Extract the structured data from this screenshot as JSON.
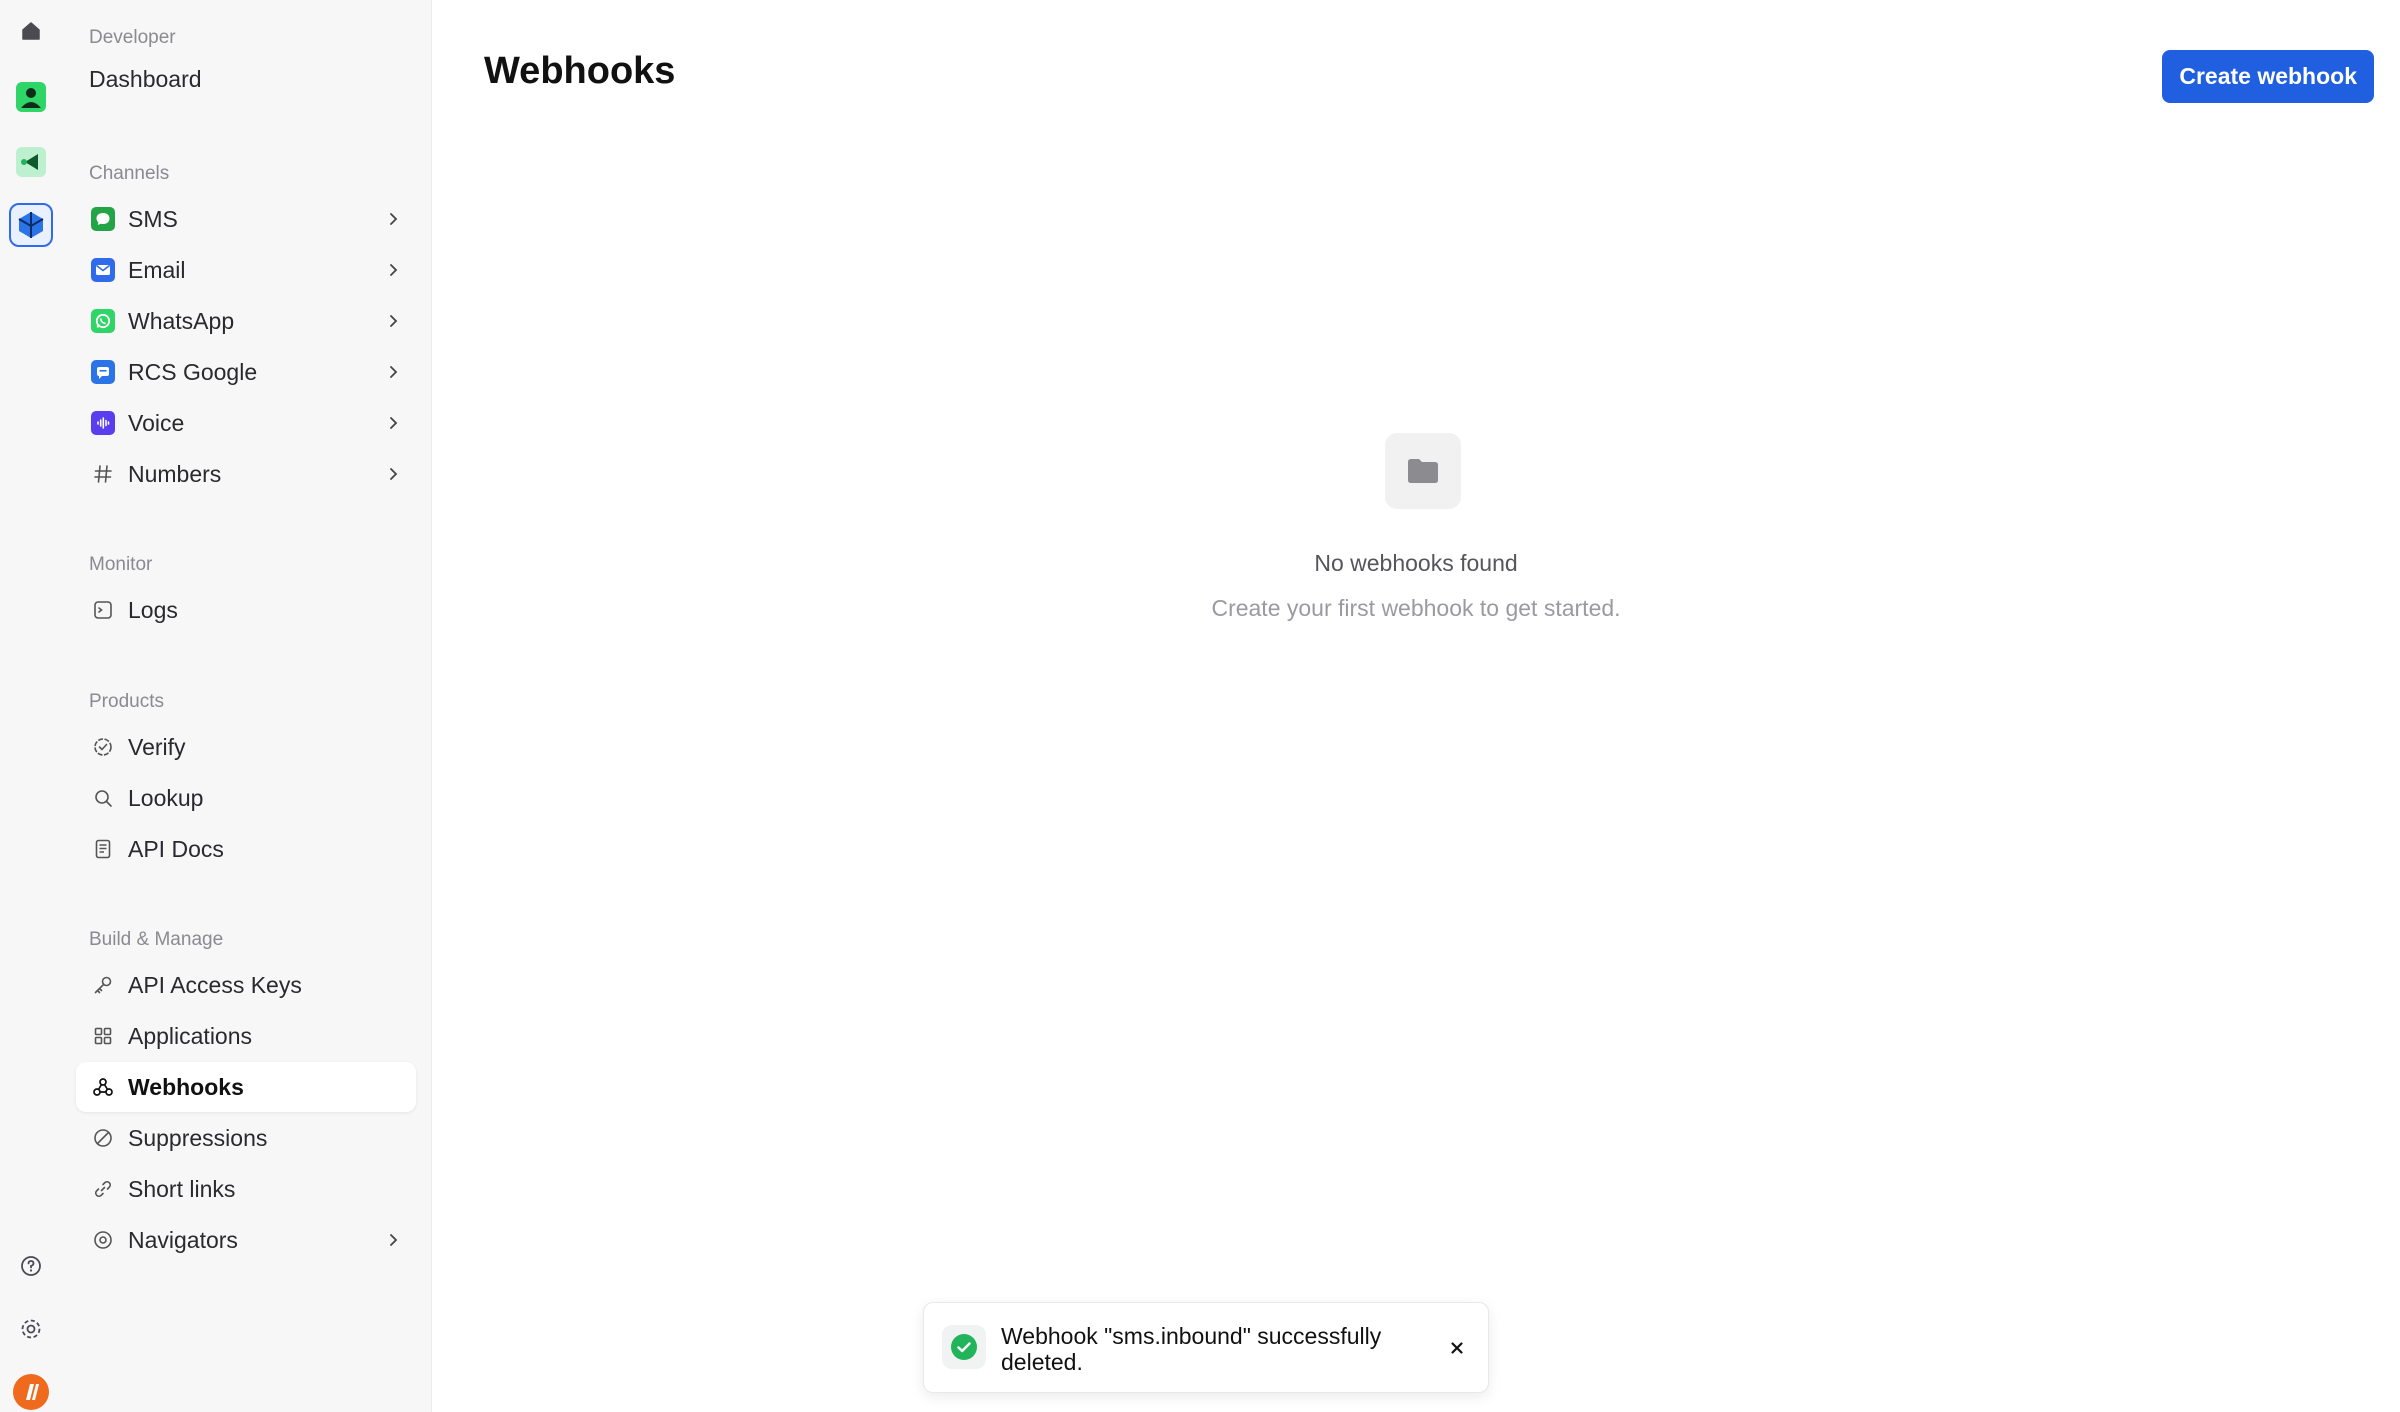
{
  "rail": {
    "icons": [
      "home-icon",
      "contact-icon",
      "video-icon",
      "cube-icon",
      "help-icon",
      "settings-icon",
      "user-avatar"
    ]
  },
  "sidebar": {
    "developer": {
      "label": "Developer",
      "dashboard": "Dashboard"
    },
    "channels": {
      "label": "Channels",
      "items": [
        {
          "label": "SMS",
          "icon": "sms-icon",
          "color": "#22a447"
        },
        {
          "label": "Email",
          "icon": "email-icon",
          "color": "#2f6bea"
        },
        {
          "label": "WhatsApp",
          "icon": "whatsapp-icon",
          "color": "#2fd566"
        },
        {
          "label": "RCS Google",
          "icon": "rcs-icon",
          "color": "#2b74e8"
        },
        {
          "label": "Voice",
          "icon": "voice-icon",
          "color": "#5b3df0"
        },
        {
          "label": "Numbers",
          "icon": "hash-icon"
        }
      ]
    },
    "monitor": {
      "label": "Monitor",
      "items": [
        {
          "label": "Logs",
          "icon": "terminal-icon"
        }
      ]
    },
    "products": {
      "label": "Products",
      "items": [
        {
          "label": "Verify",
          "icon": "badge-check-icon"
        },
        {
          "label": "Lookup",
          "icon": "search-icon"
        },
        {
          "label": "API Docs",
          "icon": "document-icon"
        }
      ]
    },
    "build": {
      "label": "Build & Manage",
      "items": [
        {
          "label": "API Access Keys",
          "icon": "key-icon"
        },
        {
          "label": "Applications",
          "icon": "grid-icon"
        },
        {
          "label": "Webhooks",
          "icon": "webhook-icon",
          "active": true
        },
        {
          "label": "Suppressions",
          "icon": "ban-icon"
        },
        {
          "label": "Short links",
          "icon": "link-icon"
        },
        {
          "label": "Navigators",
          "icon": "compass-icon"
        }
      ]
    }
  },
  "main": {
    "title": "Webhooks",
    "create_button": "Create webhook",
    "empty": {
      "icon": "folder-icon",
      "title": "No webhooks found",
      "subtitle": "Create your first webhook to get started."
    }
  },
  "toast": {
    "message": "Webhook \"sms.inbound\" successfully deleted.",
    "icon": "check-circle-icon",
    "close_icon": "close-icon"
  },
  "colors": {
    "accent": "#1f5fe0",
    "success": "#22b45a",
    "sidebar_bg": "#f7f7f8"
  }
}
